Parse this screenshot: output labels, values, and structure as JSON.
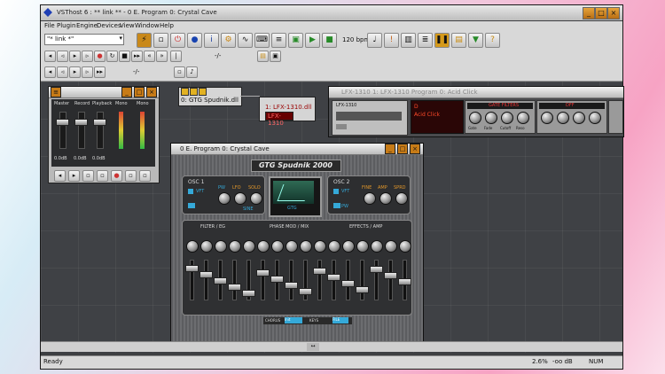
{
  "window": {
    "title": "VSThost 6 : ** link ** - 0 E. Program 0: Crystal Cave",
    "min_icon": "minimize-icon",
    "max_icon": "maximize-icon",
    "close_icon": "close-icon"
  },
  "menu": [
    "File",
    "Plugin",
    "Engine",
    "Devices",
    "View",
    "Window",
    "Help"
  ],
  "toolbar": {
    "dropdown_value": "\"* link *\"",
    "bpm": "120 bpm",
    "position": "-/-",
    "position2": "-/-"
  },
  "mixer": {
    "title": "",
    "labels": [
      "Master",
      "Record",
      "Playback",
      "Mono",
      "Mono"
    ],
    "db": [
      "0.0dB",
      "0.0dB",
      "0.0dB"
    ]
  },
  "nodes": {
    "gtg": "0: GTG Spudnik.dll",
    "lfx_a": "1: LFX-1310.dll",
    "lfx_b": "LFX-1310"
  },
  "lfx": {
    "title": "LFX-1310 1: LFX-1310 Program 0: Acid Click",
    "brand": "LFX-1310",
    "display": "Acid Click",
    "display_prefix": "D",
    "section": "GATE FILTERS",
    "sec_b": "DFF",
    "labels": [
      "Gate",
      "Fade",
      "Cutoff",
      "Reso"
    ]
  },
  "gtg": {
    "title": "0 E. Program 0: Crystal Cave",
    "logo": "GTG Spudnik 2000",
    "osc1": "OSC 1",
    "osc2": "OSC 2",
    "screen": "GTG",
    "osc1_btn": "VFT",
    "osc1_btn2": "SINE",
    "osc2_btn": "VFT",
    "osc2_btn2": "PW",
    "mid_labels": [
      "PW",
      "LFO",
      "SOLO"
    ],
    "osc2_labels": [
      "FINE",
      "AMP",
      "SPRD"
    ],
    "sec_filter": "FILTER / EG",
    "sec_phase": "PHASE MOD / MIX",
    "sec_fx": "EFFECTS / AMP",
    "bottom": [
      "CHORUS",
      "Init",
      "KEYS",
      "FILE"
    ]
  },
  "status": {
    "left": "Ready",
    "cpu": "2.6%",
    "db": "-oo dB",
    "num": "NUM"
  }
}
